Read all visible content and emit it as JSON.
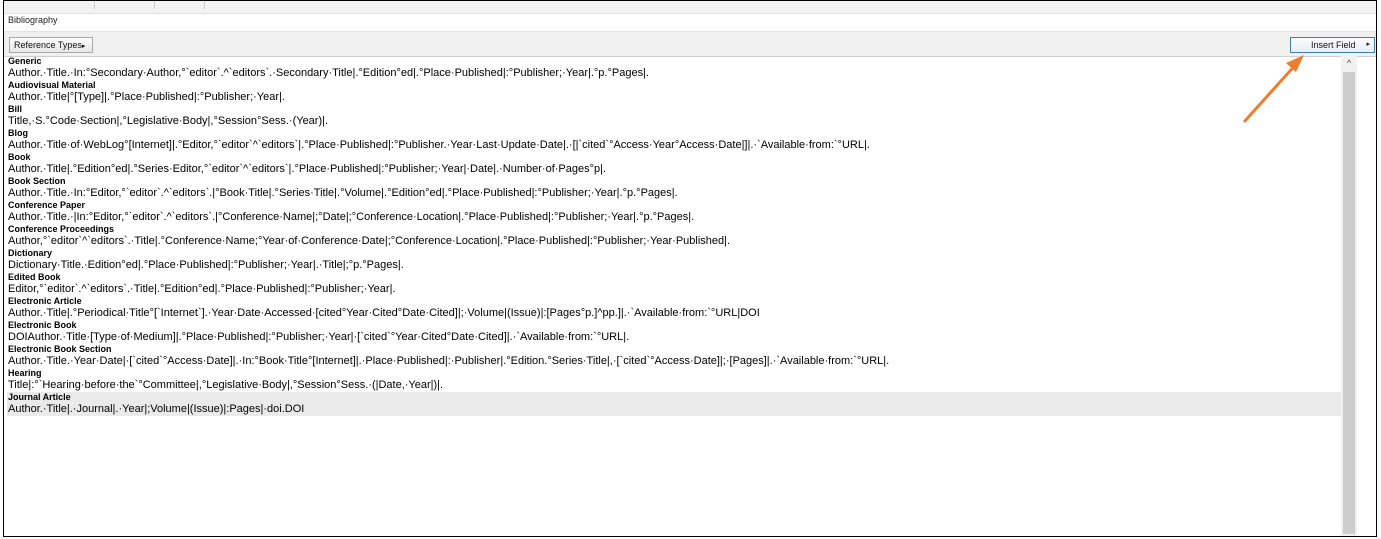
{
  "panel": {
    "title": "Bibliography"
  },
  "toolbar": {
    "reference_types_label": "Reference Types",
    "reference_types_arrow": "▸",
    "insert_field_label": "Insert Field",
    "insert_field_arrow": "▸"
  },
  "scrollbar": {
    "up_arrow": "^"
  },
  "annotation": {
    "arrow_color": "#ed7d31"
  },
  "entries": [
    {
      "type": "Generic",
      "template": "Author.·Title.·In:°Secondary·Author,°`editor`.^`editors`.·Secondary·Title|.°Edition°ed|.°Place·Published|:°Publisher;·Year|.°p.°Pages|."
    },
    {
      "type": "Audiovisual Material",
      "template": "Author.·Title|°[Type]|.°Place·Published|:°Publisher;·Year|."
    },
    {
      "type": "Bill",
      "template": "Title,·S.°Code·Section|,°Legislative·Body|,°Session°Sess.·(Year)|."
    },
    {
      "type": "Blog",
      "template": "Author.·Title·of·WebLog°[Internet]|.°Editor,°`editor`^`editors`|.°Place·Published|:°Publisher.·Year·Last·Update·Date|.·[|`cited`°Access·Year°Access·Date|]|.·`Available·from:`°URL|."
    },
    {
      "type": "Book",
      "template": "Author.·Title|.°Edition°ed|.°Series·Editor,°`editor`^`editors`|.°Place·Published|:°Publisher;·Year|·Date|.·Number·of·Pages°p|."
    },
    {
      "type": "Book Section",
      "template": "Author.·Title.·In:°Editor,°`editor`.^`editors`.|°Book·Title|.°Series·Title|.°Volume|.°Edition°ed|.°Place·Published|:°Publisher;·Year|.°p.°Pages|."
    },
    {
      "type": "Conference Paper",
      "template": "Author.·Title.·|In:°Editor,°`editor`.^`editors`.|°Conference·Name|;°Date|;°Conference·Location|.°Place·Published|:°Publisher;·Year|.°p.°Pages|."
    },
    {
      "type": "Conference Proceedings",
      "template": "Author,°`editor`^`editors`.·Title|.°Conference·Name;°Year·of·Conference·Date|;°Conference·Location|.°Place·Published|:°Publisher;·Year·Published|."
    },
    {
      "type": "Dictionary",
      "template": "Dictionary·Title.·Edition°ed|.°Place·Published|:°Publisher;·Year|.·Title|;°p.°Pages|."
    },
    {
      "type": "Edited Book",
      "template": "Editor,°`editor`.^`editors`.·Title|.°Edition°ed|.°Place·Published|:°Publisher;·Year|."
    },
    {
      "type": "Electronic Article",
      "template": "Author.·Title|.°Periodical·Title°[`Internet`].·Year·Date·Accessed·[cited°Year·Cited°Date·Cited]|;·Volume|(Issue)|:[Pages°p.]^pp.]|.·`Available·from:`°URL|DOI"
    },
    {
      "type": "Electronic Book",
      "template": "DOIAuthor.·Title·[Type·of·Medium]|.°Place·Published|:°Publisher;·Year|·[`cited`°Year·Cited°Date·Cited]|.·`Available·from:`°URL|."
    },
    {
      "type": "Electronic Book Section",
      "template": "Author.·Title.·Year·Date|·[`cited`°Access·Date]|.·In:°Book·Title°[Internet]|.·Place·Published|:·Publisher|.°Edition.°Series·Title|,·[`cited`°Access·Date]|;·[Pages]|.·`Available·from:`°URL|."
    },
    {
      "type": "Hearing",
      "template": "Title|:°`Hearing·before·the`°Committee|,°Legislative·Body|,°Session°Sess.·(|Date,·Year|)|."
    },
    {
      "type": "Journal Article",
      "template": "Author.·Title|.·Journal|.·Year|;Volume|(Issue)|:Pages|·doi.DOI"
    }
  ]
}
